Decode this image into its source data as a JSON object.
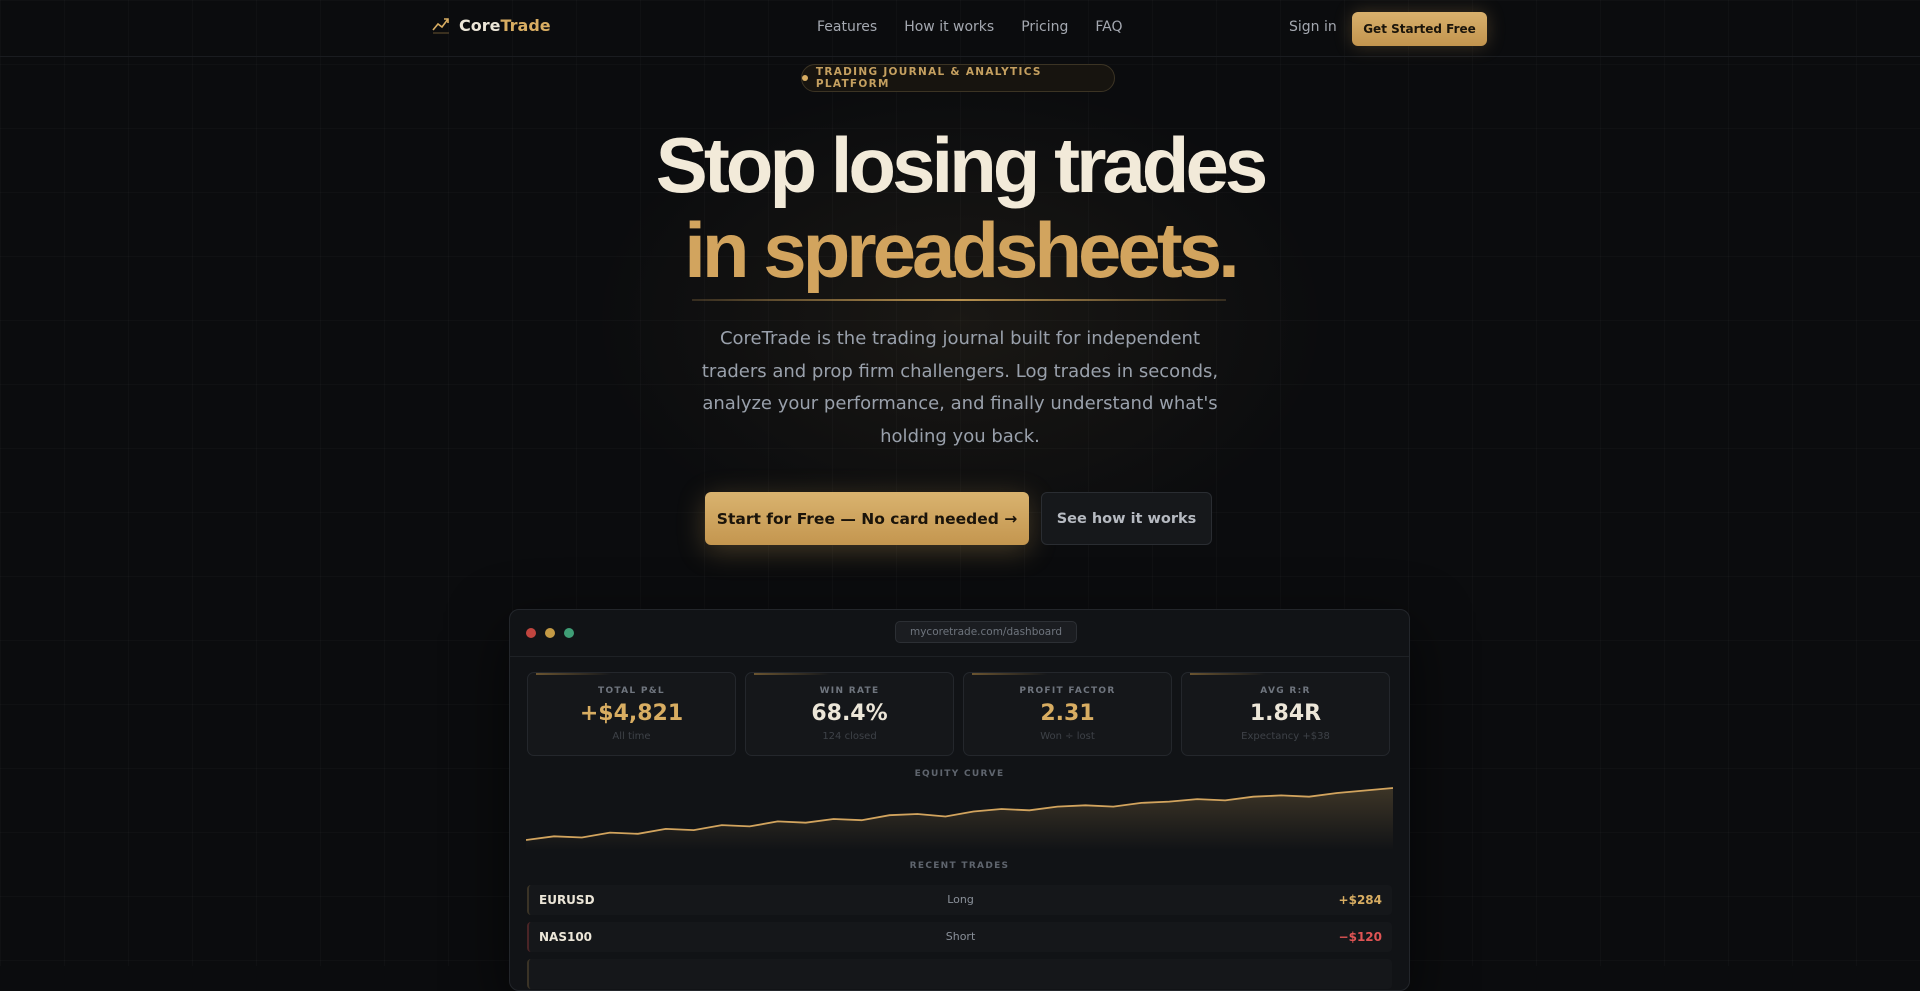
{
  "nav": {
    "brand_a": "Core",
    "brand_b": "Trade",
    "links": [
      "Features",
      "How it works",
      "Pricing",
      "FAQ"
    ],
    "sign_in": "Sign in",
    "cta": "Get Started Free"
  },
  "hero": {
    "badge": "TRADING JOURNAL & ANALYTICS PLATFORM",
    "title_line1": "Stop losing trades",
    "title_line2": "in spreadsheets.",
    "subtitle": "CoreTrade is the trading journal built for independent traders and prop firm challengers. Log trades in seconds, analyze your performance, and finally understand what's holding you back.",
    "cta_primary": "Start for Free — No card needed →",
    "cta_secondary": "See how it works"
  },
  "dashboard": {
    "url": "mycoretrade.com/dashboard",
    "stats": [
      {
        "label": "TOTAL P&L",
        "value": "+$4,821",
        "sub": "All time"
      },
      {
        "label": "WIN RATE",
        "value": "68.4%",
        "sub": "124 closed"
      },
      {
        "label": "PROFIT FACTOR",
        "value": "2.31",
        "sub": "Won ÷ lost"
      },
      {
        "label": "AVG R:R",
        "value": "1.84R",
        "sub": "Expectancy +$38"
      }
    ],
    "equity_label": "EQUITY CURVE",
    "equity_values": [
      10,
      13,
      12,
      16,
      15,
      19,
      18,
      22,
      21,
      25,
      24,
      27,
      26,
      30,
      31,
      29,
      33,
      35,
      34,
      37,
      38,
      37,
      40,
      41,
      43,
      42,
      45,
      46,
      45,
      48,
      50,
      52
    ],
    "trades_label": "RECENT TRADES",
    "trades": [
      {
        "symbol": "EURUSD",
        "side": "Long",
        "pnl": "+$284"
      },
      {
        "symbol": "NAS100",
        "side": "Short",
        "pnl": "−$120"
      }
    ]
  },
  "colors": {
    "accent": "#d8ad62",
    "background": "#0b0c0e",
    "loss": "#e05454"
  }
}
